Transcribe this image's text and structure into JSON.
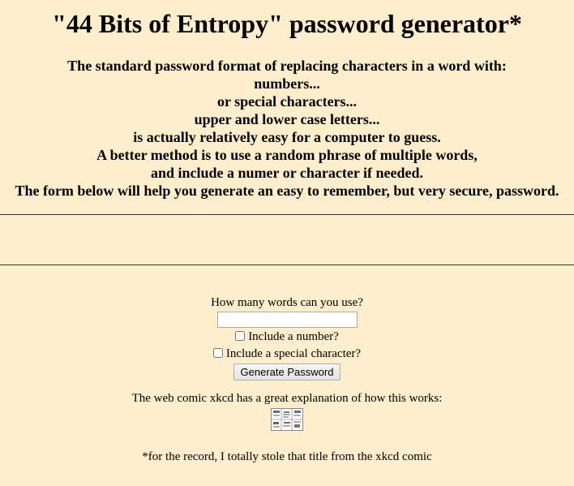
{
  "title": "\"44 Bits of Entropy\" password generator*",
  "intro": {
    "lines": [
      "The standard password format of replacing characters in a word with:",
      "numbers...",
      "or special characters...",
      "upper and lower case letters...",
      "is actually relatively easy for a computer to guess.",
      "A better method is to use a random phrase of multiple words,",
      "and include a numer or character if needed.",
      "The form below will help you generate an easy to remember, but very secure, password."
    ]
  },
  "form": {
    "words_label": "How many words can you use?",
    "words_value": "",
    "include_number_label": "Include a number?",
    "include_number_checked": false,
    "include_special_label": "Include a special character?",
    "include_special_checked": false,
    "generate_button_label": "Generate Password"
  },
  "xkcd_text": "The web comic xkcd has a great explanation of how this works:",
  "footer_note": "*for the record, I totally stole that title from the xkcd comic",
  "colors": {
    "background": "#feeecb"
  },
  "icons": {
    "comic_thumbnail": "xkcd-comic-thumbnail"
  }
}
